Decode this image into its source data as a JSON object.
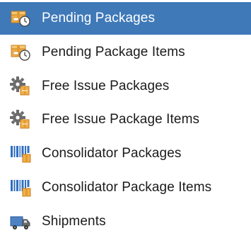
{
  "nav": {
    "items": [
      {
        "label": "Pending Packages",
        "icon": "package-clock-icon",
        "selected": true
      },
      {
        "label": "Pending Package Items",
        "icon": "package-clock-icon",
        "selected": false
      },
      {
        "label": "Free Issue Packages",
        "icon": "gear-package-icon",
        "selected": false
      },
      {
        "label": "Free Issue Package Items",
        "icon": "gear-package-icon",
        "selected": false
      },
      {
        "label": "Consolidator Packages",
        "icon": "barcode-package-icon",
        "selected": false
      },
      {
        "label": "Consolidator Package Items",
        "icon": "barcode-package-icon",
        "selected": false
      },
      {
        "label": "Shipments",
        "icon": "truck-icon",
        "selected": false
      }
    ]
  },
  "colors": {
    "selection": "#3f79b8",
    "text": "#1b1b1b",
    "box": "#f2b04b",
    "gear": "#6b6b6b",
    "barcode": "#2f6fc0"
  }
}
